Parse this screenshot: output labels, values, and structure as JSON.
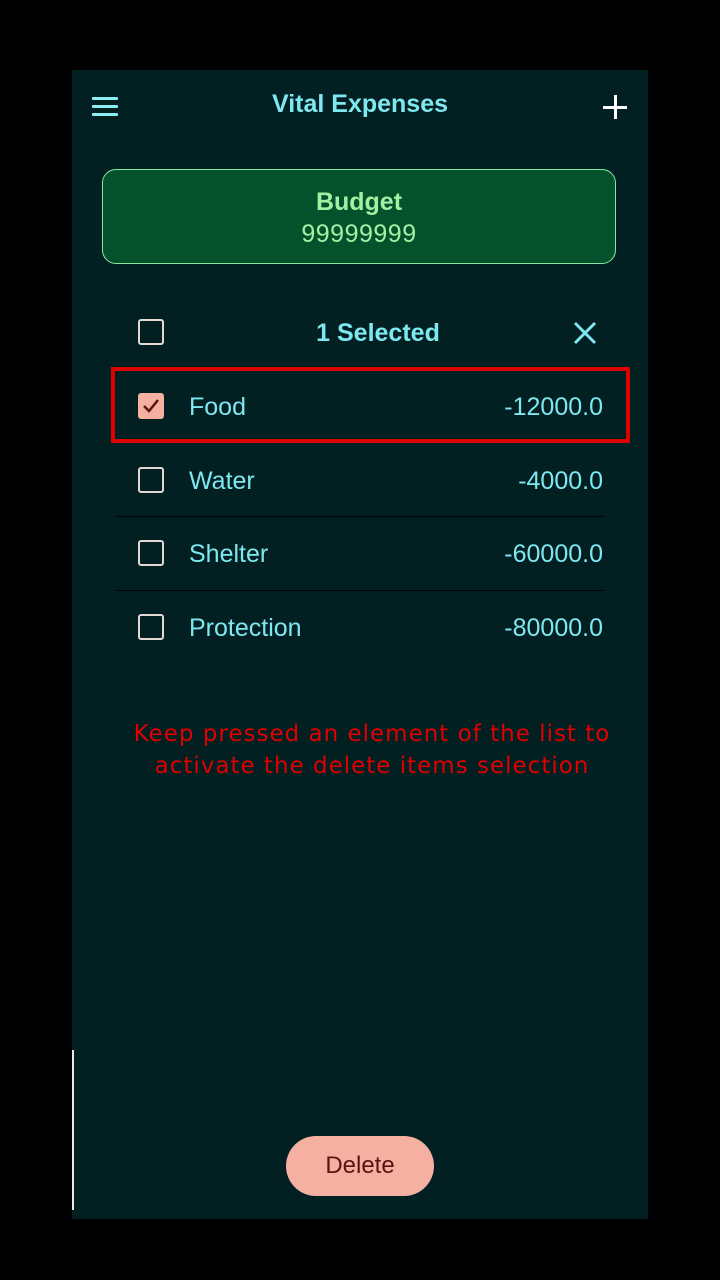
{
  "app_bar": {
    "title": "Vital Expenses",
    "menu_icon": "hamburger-menu-icon",
    "add_icon": "plus-icon"
  },
  "budget": {
    "label": "Budget",
    "value": "99999999"
  },
  "selection": {
    "count_label": "1 Selected",
    "select_all_checked": false,
    "close_icon": "close-icon"
  },
  "items": [
    {
      "name": "Food",
      "amount": "-12000.0",
      "checked": true
    },
    {
      "name": "Water",
      "amount": "-4000.0",
      "checked": false
    },
    {
      "name": "Shelter",
      "amount": "-60000.0",
      "checked": false
    },
    {
      "name": "Protection",
      "amount": "-80000.0",
      "checked": false
    }
  ],
  "hint": {
    "line1": "Keep pressed an element of the list to",
    "line2": "activate the delete items selection"
  },
  "actions": {
    "delete_label": "Delete"
  },
  "colors": {
    "background": "#021F22",
    "accent_text": "#7EE8F0",
    "budget_card": "#04522B",
    "budget_text": "#A3F0A3",
    "highlight": "#E00000",
    "checkbox_checked": "#F6B0A2",
    "delete_button": "#F6B0A2"
  }
}
